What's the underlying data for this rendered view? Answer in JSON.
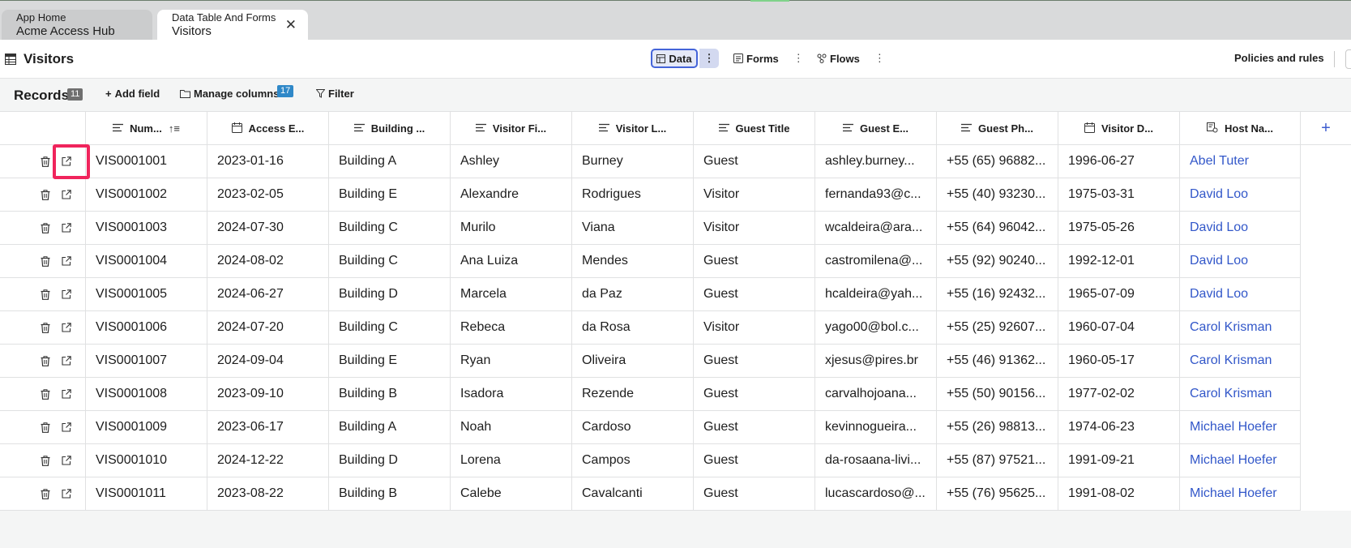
{
  "tabs": [
    {
      "subtitle": "App Home",
      "title": "Acme Access Hub"
    },
    {
      "subtitle": "Data Table And Forms",
      "title": "Visitors",
      "close": "✕"
    }
  ],
  "header": {
    "page_title": "Visitors",
    "views": {
      "data": "Data",
      "forms": "Forms",
      "flows": "Flows"
    },
    "policies": "Policies and rules"
  },
  "toolbar": {
    "records_label": "Records",
    "records_count": "11",
    "add_field": "Add field",
    "manage_columns": "Manage columns",
    "manage_columns_count": "17",
    "filter": "Filter"
  },
  "columns": [
    {
      "label": "Num...",
      "icon": "text-lines-icon",
      "sorted": true
    },
    {
      "label": "Access E...",
      "icon": "calendar-icon"
    },
    {
      "label": "Building ...",
      "icon": "text-lines-icon"
    },
    {
      "label": "Visitor Fi...",
      "icon": "text-lines-icon"
    },
    {
      "label": "Visitor L...",
      "icon": "text-lines-icon"
    },
    {
      "label": "Guest Title",
      "icon": "text-lines-icon"
    },
    {
      "label": "Guest E...",
      "icon": "text-lines-icon"
    },
    {
      "label": "Guest Ph...",
      "icon": "text-lines-icon"
    },
    {
      "label": "Visitor D...",
      "icon": "calendar-icon"
    },
    {
      "label": "Host Na...",
      "icon": "reference-icon"
    }
  ],
  "rows": [
    [
      "VIS0001001",
      "2023-01-16",
      "Building A",
      "Ashley",
      "Burney",
      "Guest",
      "ashley.burney...",
      "+55 (65) 96882...",
      "1996-06-27",
      "Abel Tuter"
    ],
    [
      "VIS0001002",
      "2023-02-05",
      "Building E",
      "Alexandre",
      "Rodrigues",
      "Visitor",
      "fernanda93@c...",
      "+55 (40) 93230...",
      "1975-03-31",
      "David Loo"
    ],
    [
      "VIS0001003",
      "2024-07-30",
      "Building C",
      "Murilo",
      "Viana",
      "Visitor",
      "wcaldeira@ara...",
      "+55 (64) 96042...",
      "1975-05-26",
      "David Loo"
    ],
    [
      "VIS0001004",
      "2024-08-02",
      "Building C",
      "Ana Luiza",
      "Mendes",
      "Guest",
      "castromilena@...",
      "+55 (92) 90240...",
      "1992-12-01",
      "David Loo"
    ],
    [
      "VIS0001005",
      "2024-06-27",
      "Building D",
      "Marcela",
      "da Paz",
      "Guest",
      "hcaldeira@yah...",
      "+55 (16) 92432...",
      "1965-07-09",
      "David Loo"
    ],
    [
      "VIS0001006",
      "2024-07-20",
      "Building C",
      "Rebeca",
      "da Rosa",
      "Visitor",
      "yago00@bol.c...",
      "+55 (25) 92607...",
      "1960-07-04",
      "Carol Krisman"
    ],
    [
      "VIS0001007",
      "2024-09-04",
      "Building E",
      "Ryan",
      "Oliveira",
      "Guest",
      "xjesus@pires.br",
      "+55 (46) 91362...",
      "1960-05-17",
      "Carol Krisman"
    ],
    [
      "VIS0001008",
      "2023-09-10",
      "Building B",
      "Isadora",
      "Rezende",
      "Guest",
      "carvalhojoana...",
      "+55 (50) 90156...",
      "1977-02-02",
      "Carol Krisman"
    ],
    [
      "VIS0001009",
      "2023-06-17",
      "Building A",
      "Noah",
      "Cardoso",
      "Guest",
      "kevinnogueira...",
      "+55 (26) 98813...",
      "1974-06-23",
      "Michael Hoefer"
    ],
    [
      "VIS0001010",
      "2024-12-22",
      "Building D",
      "Lorena",
      "Campos",
      "Guest",
      "da-rosaana-livi...",
      "+55 (87) 97521...",
      "1991-09-21",
      "Michael Hoefer"
    ],
    [
      "VIS0001011",
      "2023-08-22",
      "Building B",
      "Calebe",
      "Cavalcanti",
      "Guest",
      "lucascardoso@...",
      "+55 (76) 95625...",
      "1991-08-02",
      "Michael Hoefer"
    ]
  ],
  "colors": {
    "accent": "#4464d9",
    "link": "#3257c9",
    "highlight": "#f0245c",
    "badge_blue": "#2f88c8"
  }
}
